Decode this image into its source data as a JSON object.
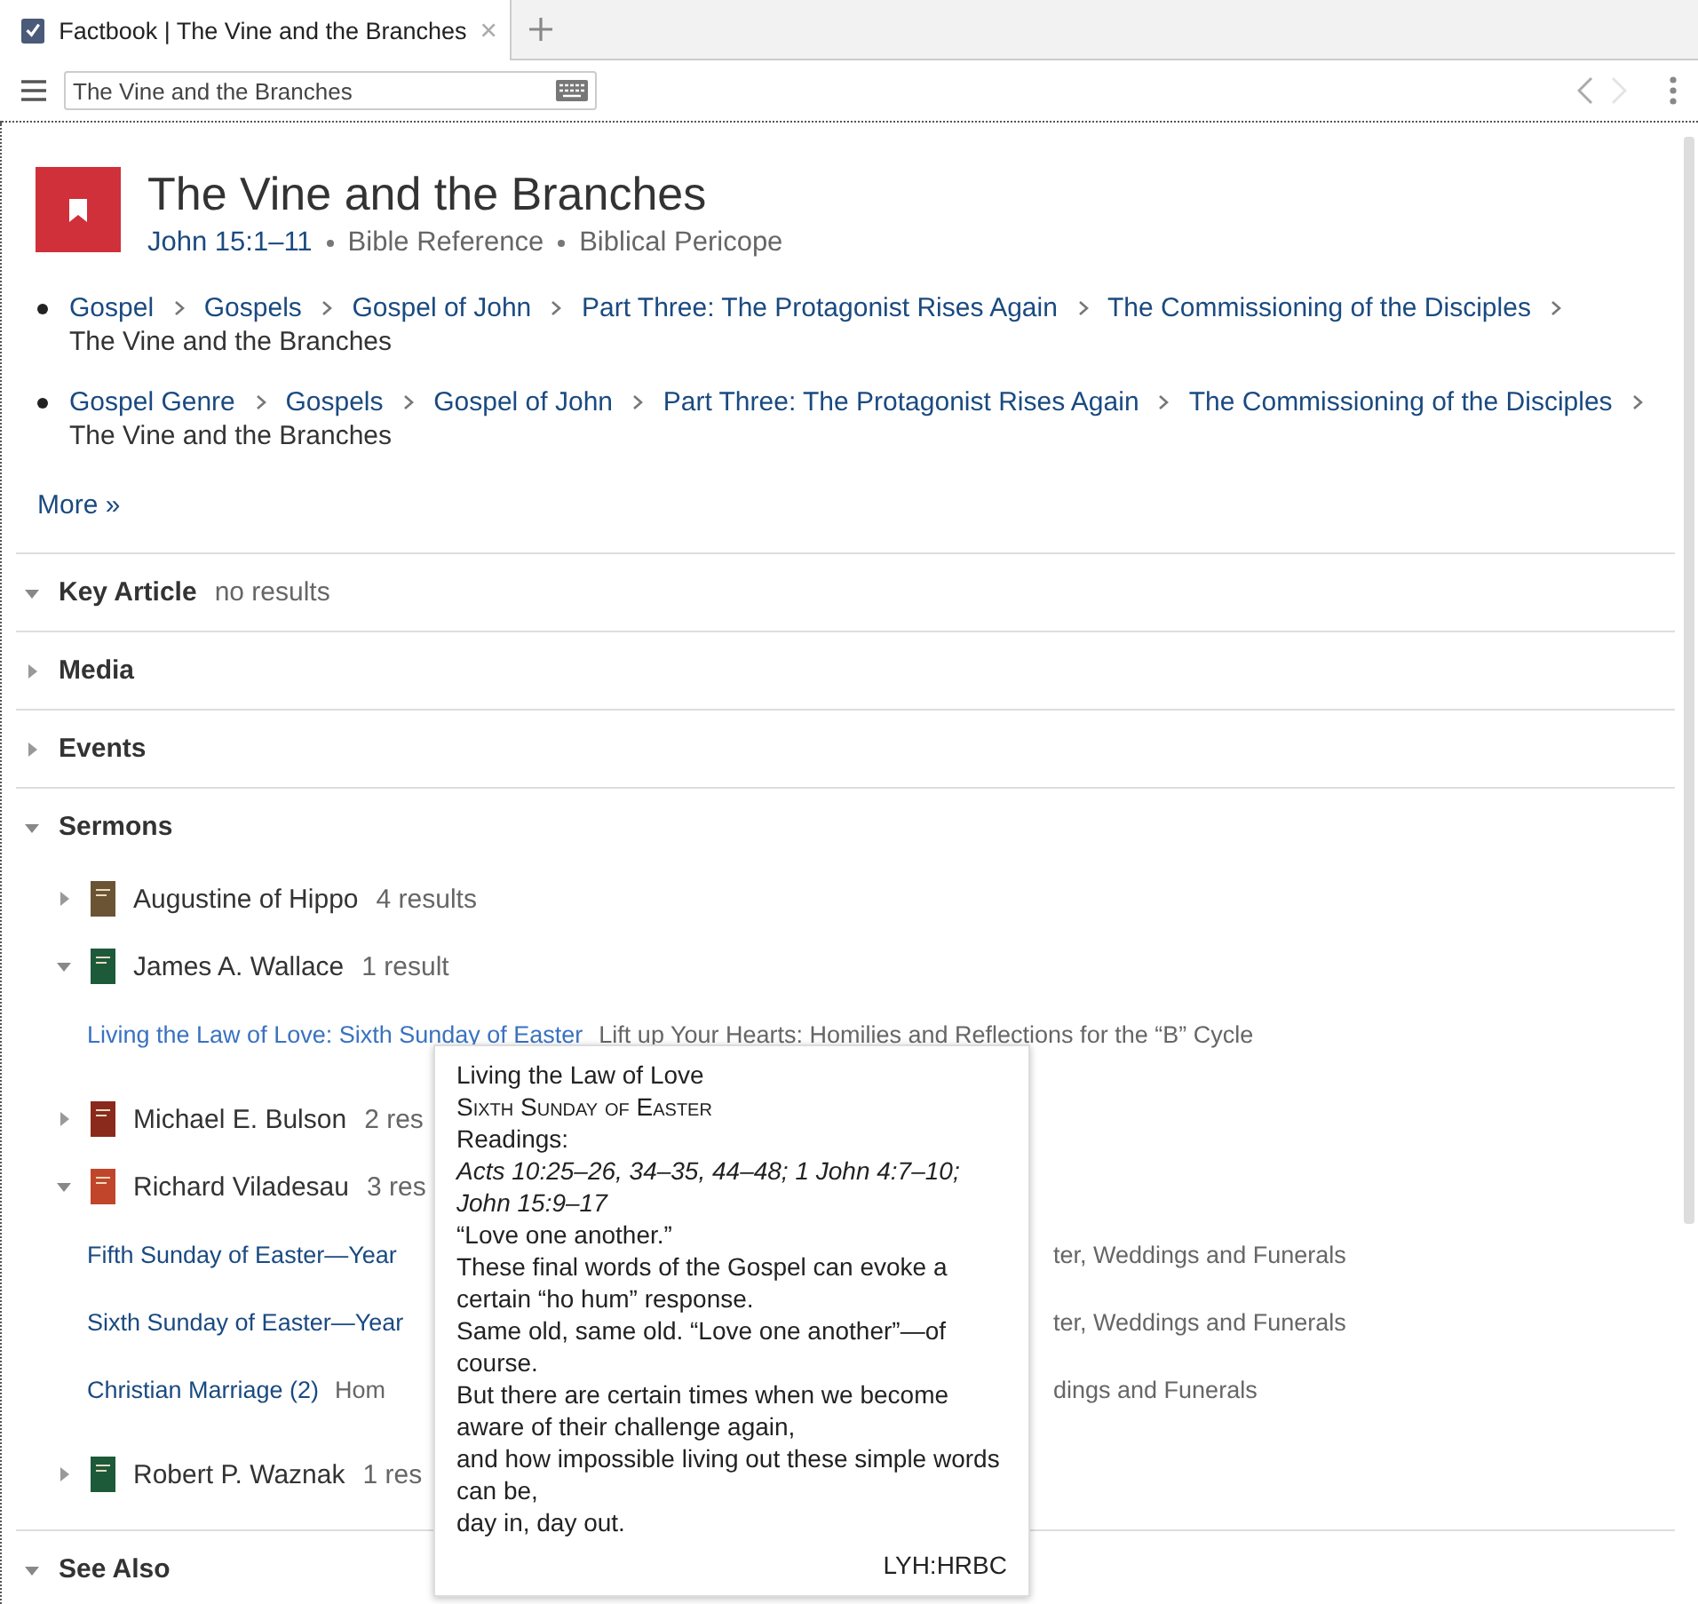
{
  "tab": {
    "title": "Factbook | The Vine and the Branches",
    "selected": true
  },
  "search": {
    "value": "The Vine and the Branches"
  },
  "nav": {
    "back_disabled": false,
    "forward_disabled": true
  },
  "header": {
    "title": "The Vine and the Branches",
    "reference": "John 15:1–11",
    "tags": [
      "Bible Reference",
      "Biblical Pericope"
    ]
  },
  "breadcrumbs": [
    [
      {
        "text": "Gospel",
        "kind": "link"
      },
      {
        "text": "Gospels",
        "kind": "link"
      },
      {
        "text": "Gospel of John",
        "kind": "link"
      },
      {
        "text": "Part Three: The Protagonist Rises Again",
        "kind": "link"
      },
      {
        "text": "The Commissioning of the Disciples",
        "kind": "link"
      },
      {
        "text": "The Vine and the Branches",
        "kind": "current"
      }
    ],
    [
      {
        "text": "Gospel Genre",
        "kind": "link"
      },
      {
        "text": "Gospels",
        "kind": "link"
      },
      {
        "text": "Gospel of John",
        "kind": "link"
      },
      {
        "text": "Part Three: The Protagonist Rises Again",
        "kind": "link"
      },
      {
        "text": "The Commissioning of the Disciples",
        "kind": "link"
      },
      {
        "text": "The Vine and the Branches",
        "kind": "current"
      }
    ]
  ],
  "more_link": "More »",
  "sections": [
    {
      "title": "Key Article",
      "expanded": true,
      "note": "no results"
    },
    {
      "title": "Media",
      "expanded": false
    },
    {
      "title": "Events",
      "expanded": false
    },
    {
      "title": "Sermons",
      "expanded": true,
      "authors": [
        {
          "name": "Augustine of Hippo",
          "count": "4 results",
          "expanded": false,
          "color": "#6b5434"
        },
        {
          "name": "James A. Wallace",
          "count": "1 result",
          "expanded": true,
          "color": "#1d5a3a",
          "results": [
            {
              "title": "Living the Law of Love: Sixth Sunday of Easter",
              "source": "Lift up Your Hearts: Homilies and Reflections for the “B” Cycle",
              "hovered": true
            }
          ]
        },
        {
          "name": "Michael E. Bulson",
          "count": "2 res",
          "expanded": false,
          "color": "#8a2a1c"
        },
        {
          "name": "Richard Viladesau",
          "count": "3 res",
          "expanded": true,
          "color": "#c0452a",
          "results": [
            {
              "title": "Fifth Sunday of Easter—Year",
              "source_tail": "ter, Weddings and Funerals",
              "hovered": false
            },
            {
              "title": "Sixth Sunday of Easter—Year",
              "source_tail": "ter, Weddings and Funerals",
              "hovered": false
            },
            {
              "title": "Christian Marriage (2)",
              "source": "Hom",
              "source_tail": "dings and Funerals",
              "hovered": false
            }
          ]
        },
        {
          "name": "Robert P. Waznak",
          "count": "1 res",
          "expanded": false,
          "color": "#1d5a3a"
        }
      ]
    },
    {
      "title": "See Also",
      "expanded": true
    }
  ],
  "tooltip": {
    "lines": [
      {
        "kind": "plain",
        "text": "Living the Law of Love"
      },
      {
        "kind": "smallcaps",
        "text": "Sixth Sunday of Easter"
      },
      {
        "kind": "plain",
        "text": "Readings:"
      },
      {
        "kind": "italic",
        "text": "Acts 10:25–26, 34–35, 44–48; 1 John 4:7–10; John 15:9–17"
      },
      {
        "kind": "plain",
        "text": "“Love one another.”"
      },
      {
        "kind": "plain",
        "text": "These final words of the Gospel can evoke a certain “ho hum” response."
      },
      {
        "kind": "plain",
        "text": "Same old, same old. “Love one another”—of course."
      },
      {
        "kind": "plain",
        "text": "But there are certain times when we become aware of their challenge again,"
      },
      {
        "kind": "plain",
        "text": "and how impossible living out these simple words can be,"
      },
      {
        "kind": "plain",
        "text": "day in, day out."
      },
      {
        "kind": "source",
        "text": "LYH:HRBC"
      }
    ]
  }
}
